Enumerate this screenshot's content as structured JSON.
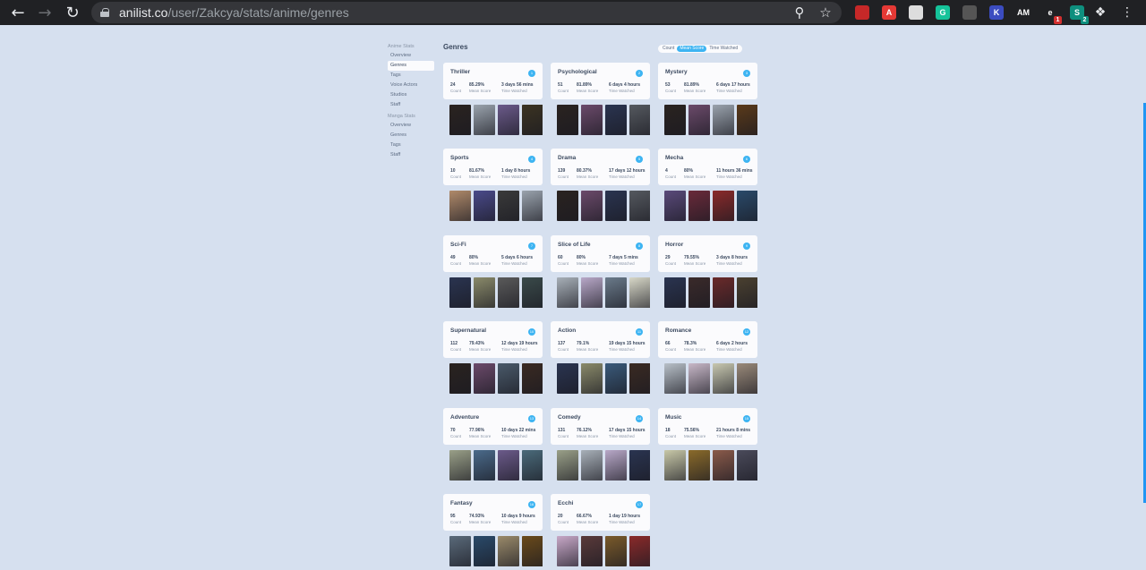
{
  "browser": {
    "url_host": "anilist.co",
    "url_path": "/user/Zakcya/stats/anime/genres",
    "extensions": [
      {
        "name": "red-bookmark-ext",
        "color": "#c62828",
        "glyph": "",
        "badge": ""
      },
      {
        "name": "acrobat-ext",
        "color": "#e53935",
        "glyph": "A",
        "badge": ""
      },
      {
        "name": "zip-ext",
        "color": "#dddddd",
        "glyph": "",
        "badge": ""
      },
      {
        "name": "grammarly-ext",
        "color": "#15c39a",
        "glyph": "G",
        "badge": ""
      },
      {
        "name": "grid-ext",
        "color": "#555555",
        "glyph": "",
        "badge": ""
      },
      {
        "name": "k-ext",
        "color": "#3b4cc0",
        "glyph": "K",
        "badge": ""
      },
      {
        "name": "am-ext",
        "color": "#202124",
        "glyph": "AM",
        "badge": ""
      },
      {
        "name": "ublock-ext",
        "color": "#202124",
        "glyph": "e",
        "badge": "1"
      },
      {
        "name": "s-ext",
        "color": "#0e8f7e",
        "glyph": "S",
        "badge": "2"
      }
    ]
  },
  "sidebar": {
    "anime_heading": "Anime Stats",
    "anime_items": [
      {
        "label": "Overview",
        "active": false
      },
      {
        "label": "Genres",
        "active": true
      },
      {
        "label": "Tags",
        "active": false
      },
      {
        "label": "Voice Actors",
        "active": false
      },
      {
        "label": "Studios",
        "active": false
      },
      {
        "label": "Staff",
        "active": false
      }
    ],
    "manga_heading": "Manga Stats",
    "manga_items": [
      {
        "label": "Overview"
      },
      {
        "label": "Genres"
      },
      {
        "label": "Tags"
      },
      {
        "label": "Staff"
      }
    ]
  },
  "main": {
    "title": "Genres",
    "sort_options": [
      {
        "label": "Count",
        "active": false
      },
      {
        "label": "Mean Score",
        "active": true
      },
      {
        "label": "Time Watched",
        "active": false
      }
    ],
    "stat_labels": {
      "count": "Count",
      "mean": "Mean Score",
      "time": "Time Watched"
    },
    "genres": [
      {
        "name": "Thriller",
        "rank": "1",
        "count": "24",
        "mean": "85.29%",
        "time": "3 days 56 mins",
        "covers": [
          "#2a2320",
          "#9aa3ad",
          "#6b5a8a",
          "#3b3322"
        ]
      },
      {
        "name": "Psychological",
        "rank": "2",
        "count": "51",
        "mean": "81.89%",
        "time": "6 days 4 hours",
        "covers": [
          "#2a2320",
          "#6b4a6a",
          "#2a3450",
          "#55595f"
        ]
      },
      {
        "name": "Mystery",
        "rank": "3",
        "count": "53",
        "mean": "81.89%",
        "time": "6 days 17 hours",
        "covers": [
          "#2a2320",
          "#6b4a6a",
          "#9aa3ad",
          "#5a3a1a"
        ]
      },
      {
        "name": "Sports",
        "rank": "4",
        "count": "10",
        "mean": "81.67%",
        "time": "1 day 8 hours",
        "covers": [
          "#b08a6a",
          "#4a4a8a",
          "#3a3a3a",
          "#9aa3ad"
        ]
      },
      {
        "name": "Drama",
        "rank": "5",
        "count": "139",
        "mean": "80.37%",
        "time": "17 days 12 hours",
        "covers": [
          "#2a2320",
          "#6b4a6a",
          "#2a3450",
          "#55595f"
        ]
      },
      {
        "name": "Mecha",
        "rank": "6",
        "count": "4",
        "mean": "80%",
        "time": "11 hours 36 mins",
        "covers": [
          "#5a4a7a",
          "#6a2a3a",
          "#8a2a2a",
          "#2a4a6a"
        ]
      },
      {
        "name": "Sci-Fi",
        "rank": "7",
        "count": "49",
        "mean": "80%",
        "time": "5 days 6 hours",
        "covers": [
          "#2a3450",
          "#8a8a6a",
          "#5a5a5a",
          "#3a4a4a"
        ]
      },
      {
        "name": "Slice of Life",
        "rank": "8",
        "count": "60",
        "mean": "80%",
        "time": "7 days 5 mins",
        "covers": [
          "#a8b0b8",
          "#b8a8c8",
          "#6a7a8a",
          "#d8d8c8"
        ]
      },
      {
        "name": "Horror",
        "rank": "9",
        "count": "29",
        "mean": "79.55%",
        "time": "3 days 8 hours",
        "covers": [
          "#2a3450",
          "#3a2a2a",
          "#6a2a2a",
          "#4a4030"
        ]
      },
      {
        "name": "Supernatural",
        "rank": "10",
        "count": "112",
        "mean": "79.43%",
        "time": "12 days 19 hours",
        "covers": [
          "#2a2320",
          "#6b4a6a",
          "#4a5a6a",
          "#3a2a22"
        ]
      },
      {
        "name": "Action",
        "rank": "11",
        "count": "137",
        "mean": "79.1%",
        "time": "19 days 15 hours",
        "covers": [
          "#2a3450",
          "#8a8a6a",
          "#3a5a7a",
          "#3a2a22"
        ]
      },
      {
        "name": "Romance",
        "rank": "12",
        "count": "66",
        "mean": "78.3%",
        "time": "6 days 2 hours",
        "covers": [
          "#b8c0c8",
          "#c8b8c8",
          "#c8c8b0",
          "#9a8a7a"
        ]
      },
      {
        "name": "Adventure",
        "rank": "13",
        "count": "70",
        "mean": "77.96%",
        "time": "10 days 22 mins",
        "covers": [
          "#9aa088",
          "#4a6a8a",
          "#6b5a8a",
          "#4a6a7a"
        ]
      },
      {
        "name": "Comedy",
        "rank": "14",
        "count": "131",
        "mean": "76.12%",
        "time": "17 days 15 hours",
        "covers": [
          "#9aa088",
          "#a8b0b8",
          "#b8a8c8",
          "#2a3450"
        ]
      },
      {
        "name": "Music",
        "rank": "15",
        "count": "18",
        "mean": "75.56%",
        "time": "21 hours 8 mins",
        "covers": [
          "#c8c8a8",
          "#8a6a2a",
          "#8a5a4a",
          "#4a4a5a"
        ]
      },
      {
        "name": "Fantasy",
        "rank": "16",
        "count": "95",
        "mean": "74.93%",
        "time": "10 days 9 hours",
        "covers": [
          "#5a6a7a",
          "#2a4a6a",
          "#9a8a6a",
          "#6a4a1a"
        ]
      },
      {
        "name": "Ecchi",
        "rank": "17",
        "count": "20",
        "mean": "66.67%",
        "time": "1 day 19 hours",
        "covers": [
          "#c8a8c8",
          "#5a3a3a",
          "#7a5a2a",
          "#8a2a2a"
        ]
      }
    ]
  }
}
